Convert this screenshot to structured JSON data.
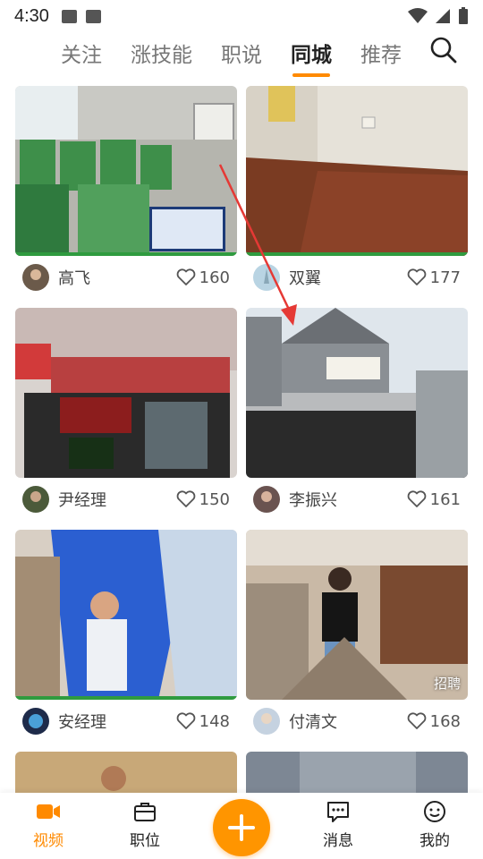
{
  "status_bar": {
    "time": "4:30"
  },
  "tabs": [
    {
      "label": "关注"
    },
    {
      "label": "涨技能"
    },
    {
      "label": "职说"
    },
    {
      "label": "同城",
      "active": true
    },
    {
      "label": "推荐"
    }
  ],
  "cards": [
    {
      "author": "高飞",
      "likes": "160"
    },
    {
      "author": "双翼",
      "likes": "177"
    },
    {
      "author": "尹经理",
      "likes": "150"
    },
    {
      "author": "李振兴",
      "likes": "161"
    },
    {
      "author": "安经理",
      "likes": "148"
    },
    {
      "author": "付清文",
      "likes": "168",
      "badge": "招聘"
    }
  ],
  "bottom_nav": [
    {
      "label": "视频",
      "icon": "video-icon",
      "active": true
    },
    {
      "label": "职位",
      "icon": "briefcase-icon"
    },
    {
      "label": "消息",
      "icon": "message-icon"
    },
    {
      "label": "我的",
      "icon": "profile-icon"
    }
  ],
  "colors": {
    "accent": "#ff8a00",
    "plus_button": "#ff9500",
    "annotation_arrow": "#e53935"
  }
}
